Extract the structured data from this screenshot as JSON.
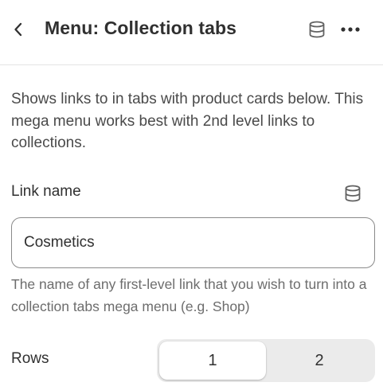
{
  "header": {
    "title": "Menu: Collection tabs",
    "back_icon": "chevron-left-icon",
    "database_icon": "database-icon",
    "more_icon": "ellipsis-icon"
  },
  "description": "Shows links to in tabs with product cards below. This mega menu works best with 2nd level links to collections.",
  "link_name": {
    "label": "Link name",
    "value": "Cosmetics",
    "icon": "database-icon",
    "help": "The name of any first-level link that you wish to turn into a collection tabs mega menu (e.g. Shop)"
  },
  "rows": {
    "label": "Rows",
    "options": [
      "1",
      "2"
    ],
    "selected": "1"
  }
}
